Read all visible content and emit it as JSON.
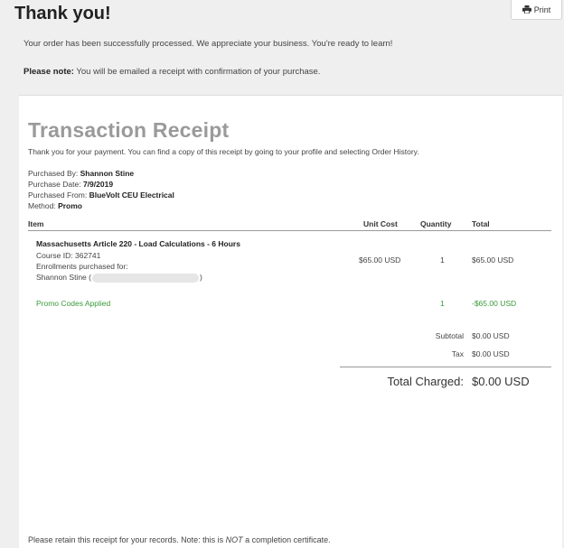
{
  "header": {
    "title": "Thank you!",
    "print_label": "Print"
  },
  "messages": {
    "processed": "Your order has been successfully processed. We appreciate your business. You're ready to learn!",
    "note_label": "Please note:",
    "note_text": " You will be emailed a receipt with confirmation of your purchase."
  },
  "receipt": {
    "title": "Transaction Receipt",
    "intro": "Thank you for your payment. You can find a copy of this receipt by going to your profile and selecting Order History.",
    "purchased_by_label": "Purchased By: ",
    "purchased_by": "Shannon Stine",
    "purchase_date_label": "Purchase Date: ",
    "purchase_date": "7/9/2019",
    "purchased_from_label": "Purchased From: ",
    "purchased_from": "BlueVolt CEU Electrical",
    "method_label": "Method: ",
    "method": "Promo",
    "columns": {
      "item": "Item",
      "unit_cost": "Unit Cost",
      "quantity": "Quantity",
      "total": "Total"
    },
    "item": {
      "name": "Massachusetts Article 220 - Load Calculations - 6 Hours",
      "course_id": "Course ID: 362741",
      "enroll_label": "Enrollments purchased for:",
      "enrollee": "Shannon Stine (",
      "enrollee_close": ")",
      "unit_cost": "$65.00 USD",
      "quantity": "1",
      "total": "$65.00 USD"
    },
    "promo": {
      "label": "Promo Codes Applied",
      "quantity": "1",
      "total": "-$65.00 USD"
    },
    "subtotal_label": "Subtotal",
    "subtotal": "$0.00 USD",
    "tax_label": "Tax",
    "tax": "$0.00 USD",
    "total_label": "Total Charged:",
    "total": "$0.00 USD",
    "footer_a": "Please retain this receipt for your records. Note: this is ",
    "footer_not": "NOT",
    "footer_b": " a completion certificate."
  }
}
